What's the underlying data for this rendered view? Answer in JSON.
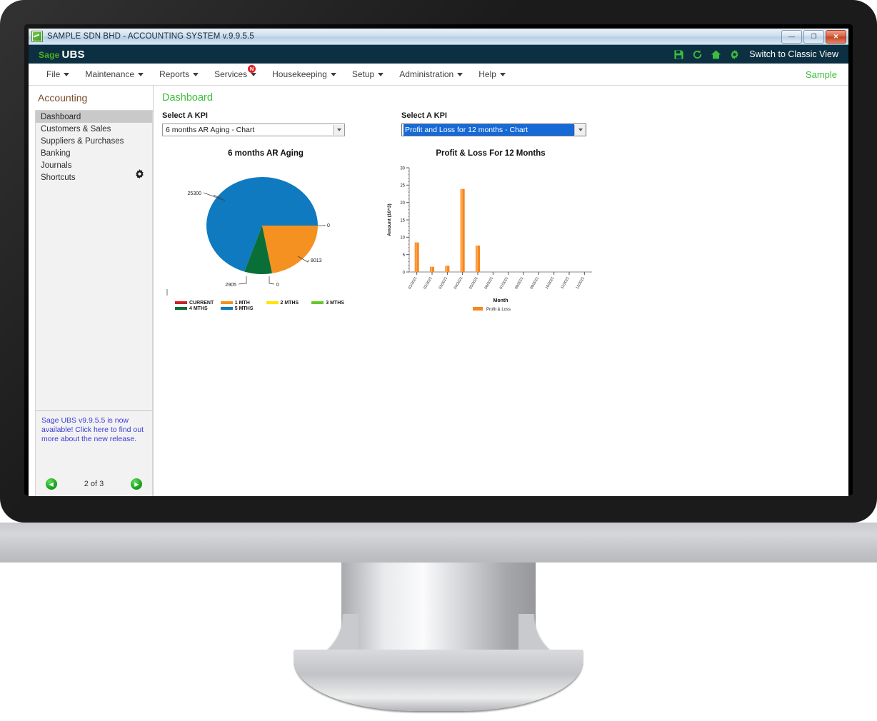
{
  "window": {
    "title": "SAMPLE SDN BHD - ACCOUNTING SYSTEM v.9.9.5.5",
    "app_icon": "chart-app-icon",
    "buttons": {
      "minimize": "—",
      "restore": "❐",
      "close": "✕"
    }
  },
  "brand_bar": {
    "logo_sage": "Sage",
    "logo_ubs": "UBS",
    "icons": [
      "save-icon",
      "refresh-icon",
      "home-icon",
      "settings-icon"
    ],
    "classic_view_label": "Switch to Classic View"
  },
  "menubar": {
    "items": [
      {
        "label": "File",
        "badge": null
      },
      {
        "label": "Maintenance",
        "badge": null
      },
      {
        "label": "Reports",
        "badge": null
      },
      {
        "label": "Services",
        "badge": "N"
      },
      {
        "label": "Housekeeping",
        "badge": null
      },
      {
        "label": "Setup",
        "badge": null
      },
      {
        "label": "Administration",
        "badge": null
      },
      {
        "label": "Help",
        "badge": null
      }
    ],
    "company": "Sample"
  },
  "sidebar": {
    "title": "Accounting",
    "items": [
      {
        "label": "Dashboard",
        "active": true
      },
      {
        "label": "Customers & Sales",
        "active": false
      },
      {
        "label": "Suppliers & Purchases",
        "active": false
      },
      {
        "label": "Banking",
        "active": false
      },
      {
        "label": "Journals",
        "active": false
      },
      {
        "label": "Shortcuts",
        "active": false
      }
    ],
    "gear_icon": "gear-icon",
    "news": {
      "text": "Sage UBS v9.9.5.5 is now available! Click here to find out more about the new release.",
      "pager_label": "2 of 3",
      "prev_icon": "◀",
      "next_icon": "▶"
    }
  },
  "content": {
    "page_title": "Dashboard",
    "kpi_left": {
      "label": "Select A KPI",
      "value": "6 months AR Aging - Chart",
      "highlighted": false
    },
    "kpi_right": {
      "label": "Select A KPI",
      "value": "Profit and Loss for 12 months - Chart",
      "highlighted": true
    }
  },
  "chart_data": [
    {
      "type": "pie",
      "title": "6 months AR Aging",
      "categories": [
        "CURRENT",
        "1 MTH",
        "2 MTHS",
        "3 MTHS",
        "4 MTHS",
        "5 MTHS"
      ],
      "values": [
        0,
        8013,
        0,
        0,
        2905,
        25300
      ],
      "colors": [
        "#cc2027",
        "#f59120",
        "#ffe400",
        "#66c92b",
        "#0a6e37",
        "#0f7ac0"
      ],
      "data_labels": [
        "0",
        "8013",
        "0",
        "0",
        "2905",
        "25300"
      ],
      "legend_position": "bottom",
      "xlabel": "",
      "ylabel": ""
    },
    {
      "type": "bar",
      "title": "Profit & Loss For 12 Months",
      "categories": [
        "01/2021",
        "02/2021",
        "03/2021",
        "04/2021",
        "05/2021",
        "06/2021",
        "07/2021",
        "08/2021",
        "09/2021",
        "10/2021",
        "11/2021",
        "12/2021"
      ],
      "series": [
        {
          "name": "Profit & Loss",
          "values": [
            8.5,
            1.5,
            1.8,
            23.9,
            7.6,
            0,
            0,
            0,
            0,
            0,
            0,
            0
          ]
        }
      ],
      "color": "#f7861f",
      "xlabel": "Month",
      "ylabel": "Amount (10^3)",
      "ylim": [
        0,
        30
      ],
      "yticks": [
        0,
        5,
        10,
        15,
        20,
        25,
        30
      ],
      "grid": false,
      "legend_position": "bottom"
    }
  ]
}
